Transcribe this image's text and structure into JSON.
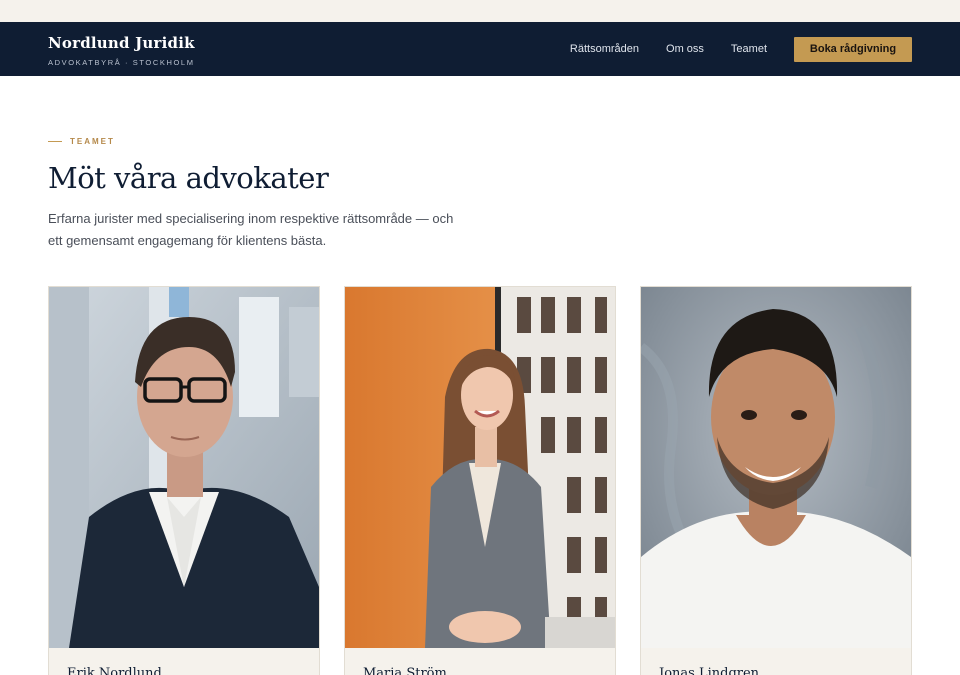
{
  "brand": {
    "name": "Nordlund Juridik",
    "tagline": "ADVOKATBYRÅ · STOCKHOLM"
  },
  "nav": {
    "items": [
      {
        "label": "Rättsområden"
      },
      {
        "label": "Om oss"
      },
      {
        "label": "Teamet"
      }
    ],
    "cta_label": "Boka rådgivning"
  },
  "section": {
    "eyebrow": "TEAMET",
    "title": "Möt våra advokater",
    "intro": "Erfarna jurister med specialisering inom respektive rättsområde — och ett gemensamt engagemang för klientens bästa."
  },
  "team": [
    {
      "name": "Erik Nordlund"
    },
    {
      "name": "Maria Ström"
    },
    {
      "name": "Jonas Lindgren"
    }
  ],
  "colors": {
    "navy": "#0f1d33",
    "gold": "#c49a52",
    "cream": "#f5f2ec"
  }
}
